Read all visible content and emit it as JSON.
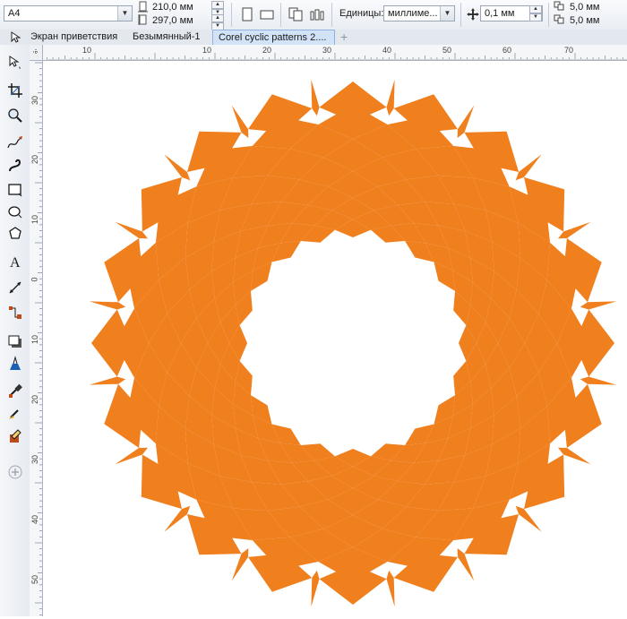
{
  "property_bar": {
    "paper_size": "A4",
    "page_width": "210,0 мм",
    "page_height": "297,0 мм",
    "units_label": "Единицы:",
    "units_value": "миллиме...",
    "nudge": "0,1 мм",
    "dup_x": "5,0 мм",
    "dup_y": "5,0 мм"
  },
  "tabs": [
    {
      "label": "Экран приветствия"
    },
    {
      "label": "Безымянный-1"
    },
    {
      "label": "Corel cyclic patterns 2...."
    }
  ],
  "ruler": {
    "h_labels": [
      "10",
      "10",
      "20",
      "30",
      "40",
      "50",
      "60",
      "70"
    ],
    "v_labels": [
      "30",
      "20",
      "10",
      "0",
      "10",
      "20",
      "30",
      "40",
      "50"
    ]
  },
  "pattern": {
    "fill": "#f07f1e",
    "spikes": 20,
    "rings": 5
  },
  "icons": [
    "pick-tool-icon",
    "shape-tool-icon",
    "crop-tool-icon",
    "zoom-tool-icon",
    "freehand-tool-icon",
    "artistic-media-icon",
    "rectangle-tool-icon",
    "ellipse-tool-icon",
    "polygon-tool-icon",
    "text-tool-icon",
    "parallel-dimension-icon",
    "connector-tool-icon",
    "drop-shadow-icon",
    "transparency-icon",
    "eyedropper-icon",
    "interactive-fill-icon",
    "smart-fill-icon",
    "add-tool-icon"
  ]
}
